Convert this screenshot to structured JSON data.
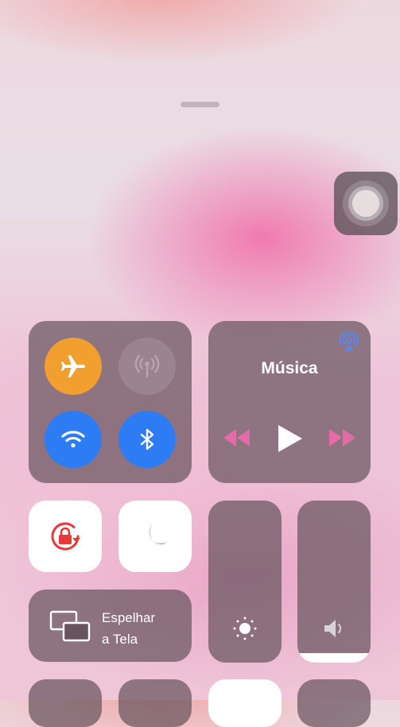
{
  "colors": {
    "airplane_active": "#f19f2f",
    "connectivity_active": "#2d7cf4",
    "rotation_lock": "#e43a3a",
    "do_not_disturb": "#5b52d6",
    "airplay": "#5b86f0",
    "media_controls_inactive": "#e56aa8"
  },
  "connectivity": {
    "airplane": {
      "icon": "airplane-icon",
      "active": true
    },
    "cellular": {
      "icon": "antenna-icon",
      "active": false
    },
    "wifi": {
      "icon": "wifi-icon",
      "active": true
    },
    "bluetooth": {
      "icon": "bluetooth-icon",
      "active": true
    }
  },
  "music": {
    "title": "Música",
    "airplay_icon": "airplay-icon",
    "controls": [
      "rewind-icon",
      "play-icon",
      "fast-forward-icon"
    ]
  },
  "toggles": {
    "rotation_lock": {
      "icon": "rotation-lock-icon",
      "active": true
    },
    "do_not_disturb": {
      "icon": "moon-icon",
      "active": true
    }
  },
  "screen_mirroring": {
    "label_line1": "Espelhar",
    "label_line2": "a Tela",
    "icon": "screen-mirroring-icon"
  },
  "sliders": {
    "brightness": {
      "icon": "sun-icon",
      "level": 0.0
    },
    "volume": {
      "icon": "speaker-icon",
      "level": 0.06
    }
  },
  "assistive_touch": {
    "icon": "assistive-touch-icon"
  }
}
